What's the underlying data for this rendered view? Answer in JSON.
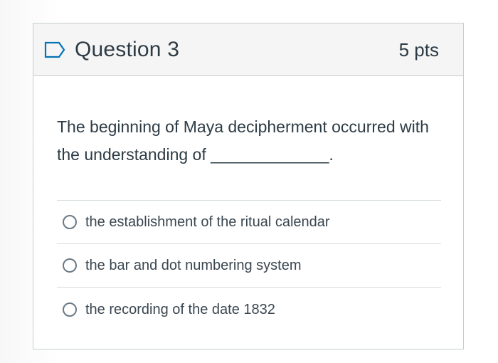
{
  "question": {
    "title": "Question 3",
    "points": "5 pts",
    "flag_icon": "flag-outline-icon",
    "text": "The beginning of Maya decipherment occurred with the understanding of _____________.",
    "answers": [
      {
        "label": "the establishment of the ritual calendar",
        "selected": false
      },
      {
        "label": "the bar and dot numbering system",
        "selected": false
      },
      {
        "label": "the recording of the date 1832",
        "selected": false
      }
    ]
  },
  "colors": {
    "text": "#2d3b45",
    "header_bg": "#f5f5f5",
    "border": "#c7cdd1",
    "flag_blue": "#0374b5",
    "radio_border": "#697985"
  }
}
